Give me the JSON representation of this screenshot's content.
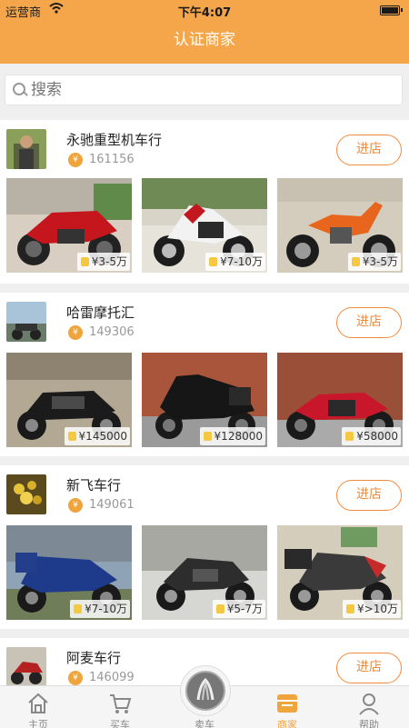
{
  "status_bar": {
    "carrier": "运营商",
    "wifi_icon": "wifi-icon",
    "time": "下午4:07",
    "battery_icon": "battery-icon"
  },
  "nav": {
    "title": "认证商家"
  },
  "search": {
    "placeholder": "搜索"
  },
  "shops": [
    {
      "name": "永驰重型机车行",
      "views": "161156",
      "enter_label": "进店",
      "bikes": [
        {
          "price": "¥3-5万"
        },
        {
          "price": "¥7-10万"
        },
        {
          "price": "¥3-5万"
        }
      ]
    },
    {
      "name": "哈雷摩托汇",
      "views": "149306",
      "enter_label": "进店",
      "bikes": [
        {
          "price": "¥145000"
        },
        {
          "price": "¥128000"
        },
        {
          "price": "¥58000"
        }
      ]
    },
    {
      "name": "新飞车行",
      "views": "149061",
      "enter_label": "进店",
      "bikes": [
        {
          "price": "¥7-10万"
        },
        {
          "price": "¥5-7万"
        },
        {
          "price": "¥>10万"
        }
      ]
    },
    {
      "name": "阿麦车行",
      "views": "146099",
      "enter_label": "进店"
    }
  ],
  "tab_bar": {
    "tabs": [
      {
        "label": "主页",
        "icon": "home-icon"
      },
      {
        "label": "买车",
        "icon": "cart-icon"
      },
      {
        "label": "卖车",
        "icon": "sell-center-icon"
      },
      {
        "label": "商家",
        "icon": "shop-icon",
        "active": true
      },
      {
        "label": "帮助",
        "icon": "user-icon"
      }
    ]
  },
  "colors": {
    "accent": "#f5a64a",
    "button": "#f08a3c",
    "coin": "#f0a43c"
  }
}
